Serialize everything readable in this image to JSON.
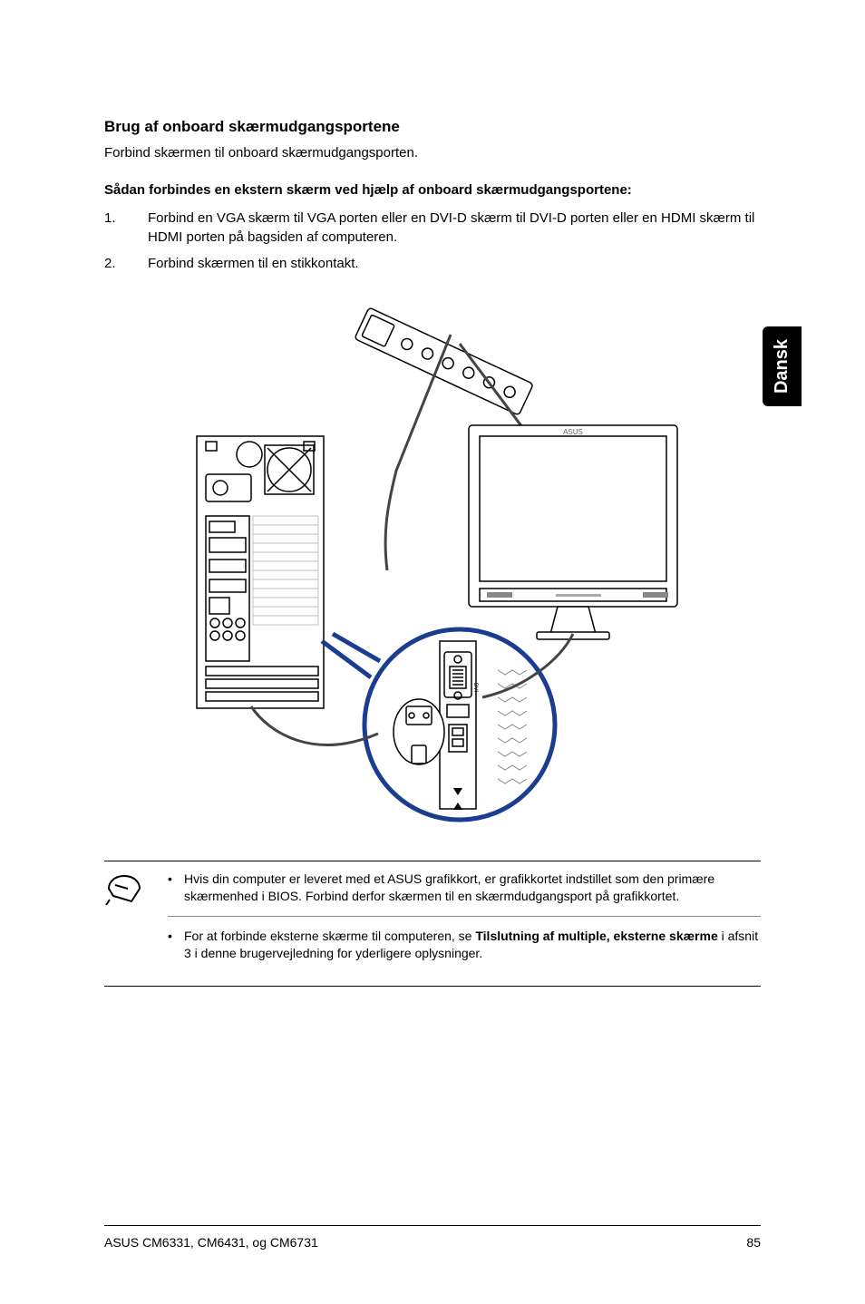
{
  "side_tab": "Dansk",
  "heading": "Brug af onboard skærmudgangsportene",
  "intro": "Forbind skærmen til onboard skærmudgangsporten.",
  "subheading": "Sådan forbindes en ekstern skærm ved hjælp af onboard skærmudgangsportene:",
  "steps": [
    {
      "num": "1.",
      "text": "Forbind en VGA skærm til VGA porten eller en DVI-D skærm til DVI-D porten eller en HDMI skærm til HDMI porten på bagsiden af computeren."
    },
    {
      "num": "2.",
      "text": "Forbind skærmen til en stikkontakt."
    }
  ],
  "notes": [
    {
      "text_prefix": "Hvis din computer er leveret med et ASUS grafikkort, er grafikkortet indstillet som den primære skærmenhed i BIOS. Forbind derfor skærmen til en skærmdudgangsport på grafikkortet.",
      "bold": "",
      "text_suffix": ""
    },
    {
      "text_prefix": "For at forbinde eksterne skærme til computeren, se ",
      "bold": "Tilslutning af multiple, eksterne skærme",
      "text_suffix": " i afsnit 3 i denne brugervejledning for yderligere oplysninger."
    }
  ],
  "footer_left": "ASUS CM6331, CM6431, og CM6731",
  "footer_right": "85"
}
